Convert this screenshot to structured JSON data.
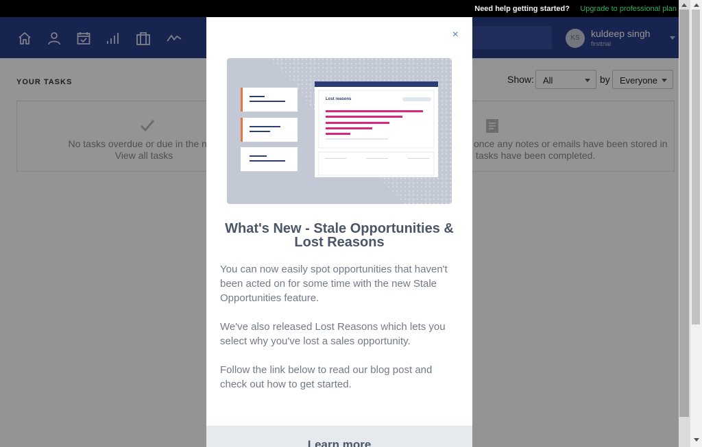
{
  "topbar": {
    "help_text": "Need help getting started?",
    "upgrade_link": "Upgrade to professional plan"
  },
  "nav": {
    "icons": [
      "home-icon",
      "contacts-icon",
      "calendar-icon",
      "reports-icon",
      "briefcase-icon",
      "activity-icon"
    ],
    "user": {
      "initials": "KS",
      "name": "kuldeep singh",
      "account": "firsttrial"
    }
  },
  "tasks": {
    "heading": "YOUR TASKS",
    "show_label": "Show:",
    "show_value": "All",
    "by_label": "by",
    "by_value": "Everyone",
    "left_panel": {
      "line1": "No tasks overdue or due in the next",
      "line2": "View all tasks"
    },
    "right_panel": {
      "line1": "once any notes or emails have been stored in",
      "line2": "tasks have been completed."
    }
  },
  "modal": {
    "close_label": "×",
    "illustration": {
      "card_title": "Lost reasons"
    },
    "title": "What's New - Stale Opportunities & Lost Reasons",
    "paragraph1": "You can now easily spot opportunities that haven't been acted on for some time with the new Stale Opportunities feature.",
    "paragraph2": "We've also released Lost Reasons which lets you select why you've lost a sales opportunity.",
    "paragraph3": "Follow the link below to read our blog post and check out how to get started.",
    "cta_label": "Learn more"
  },
  "colors": {
    "nav_bg": "#2a3e8a",
    "upgrade_green": "#2fae5a",
    "accent_pink": "#d6287a",
    "accent_orange": "#e9733a"
  }
}
